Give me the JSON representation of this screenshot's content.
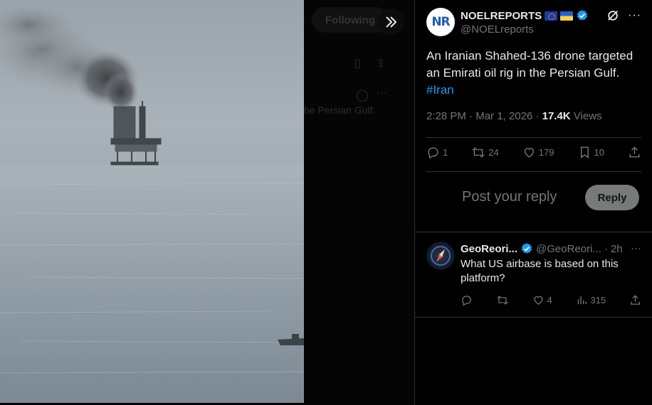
{
  "background": {
    "following_label": "Following",
    "ghost_text": "he Persian Gulf."
  },
  "post": {
    "author_name": "NOELREPORTS",
    "author_handle": "@NOELreports",
    "avatar_text": "NR",
    "text": "An Iranian Shahed-136 drone targeted an Emirati oil rig in the Persian Gulf.",
    "hashtag": "#Iran",
    "time": "2:28 PM",
    "date": "Mar 1, 2026",
    "views_count": "17.4K",
    "views_label": "Views",
    "stats": {
      "replies": "1",
      "reposts": "24",
      "likes": "179",
      "bookmarks": "10"
    }
  },
  "reply_box": {
    "placeholder": "Post your reply",
    "button_label": "Reply"
  },
  "reply": {
    "author_name": "GeoReori...",
    "author_handle": "@GeoReori...",
    "time": "2h",
    "text": "What US airbase is based on this platform?",
    "stats": {
      "likes": "4",
      "views": "315"
    }
  },
  "colors": {
    "accent": "#1d9bf0",
    "muted": "#71767b",
    "divider": "#2f3336",
    "reply_button": "#787a7a"
  }
}
